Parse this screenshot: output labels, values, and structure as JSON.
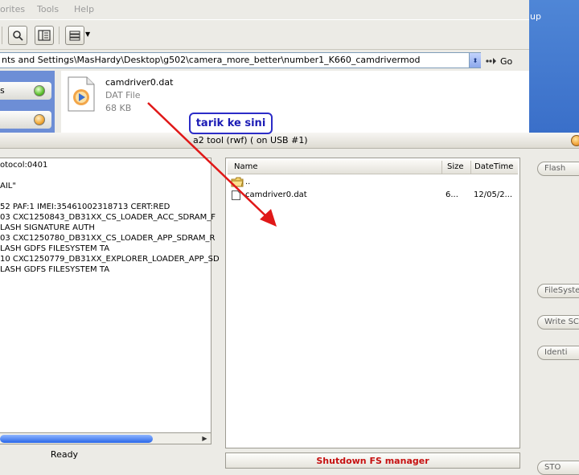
{
  "explorer": {
    "menu": [
      "orites",
      "Tools",
      "Help"
    ],
    "address": "nts and Settings\\MasHardy\\Desktop\\g502\\camera_more_better\\number1_K660_camdrivermod",
    "go_label": "Go",
    "left_tasks": [
      "s",
      ""
    ],
    "file": {
      "name": "camdriver0.dat",
      "type": "DAT File",
      "size": "68 KB"
    }
  },
  "desktop": {
    "partial_label": "up"
  },
  "callout": {
    "text": "tarik ke sini"
  },
  "a2": {
    "title": "a2 tool (rwf) ( on USB #1)",
    "log_lines": [
      "otocol:0401",
      "",
      "AIL\"",
      "",
      "52 PAF:1 IMEI:35461002318713 CERT:RED",
      "03 CXC1250843_DB31XX_CS_LOADER_ACC_SDRAM_F",
      "LASH SIGNATURE AUTH",
      "03 CXC1250780_DB31XX_CS_LOADER_APP_SDRAM_R",
      "LASH GDFS FILESYSTEM TA",
      "10 CXC1250779_DB31XX_EXPLORER_LOADER_APP_SD",
      "LASH GDFS FILESYSTEM TA"
    ],
    "status": "Ready",
    "fs": {
      "columns": [
        "Name",
        "Size",
        "DateTime"
      ],
      "rows": [
        {
          "name": "..",
          "size": "",
          "date": "",
          "icon": "folder-icon"
        },
        {
          "name": "camdriver0.dat",
          "size": "6...",
          "date": "12/05/2...",
          "icon": "file-icon"
        }
      ]
    },
    "shutdown_label": "Shutdown FS manager",
    "side_buttons": [
      "Flash",
      "FileSystem",
      "Write SC",
      "Identi",
      "STO"
    ]
  },
  "colors": {
    "callout_blue": "#1c1cb5",
    "arrow_red": "#e01818",
    "shutdown_red": "#c61010"
  }
}
